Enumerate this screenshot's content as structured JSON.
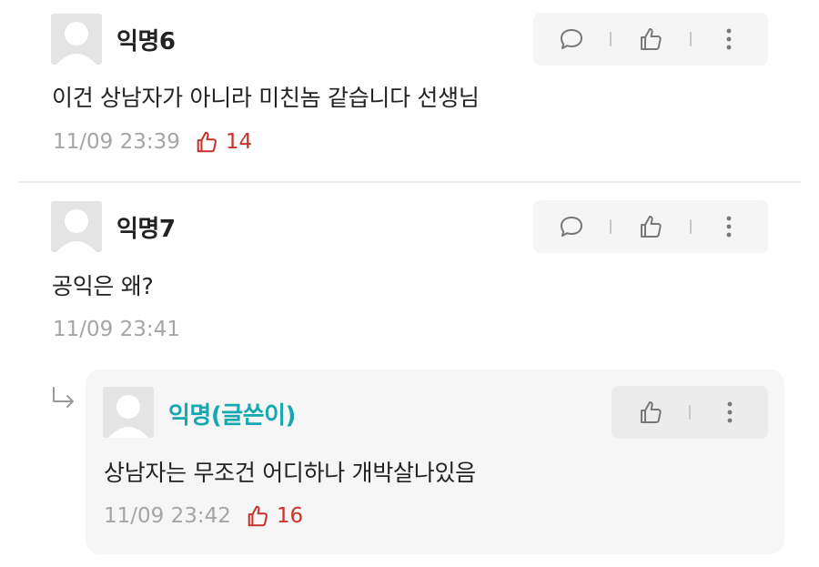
{
  "comments": [
    {
      "author": "익명6",
      "text": "이건 상남자가 아니라 미친놈 같습니다 선생님",
      "timestamp": "11/09 23:39",
      "likes": "14",
      "actions": [
        "comment-icon",
        "thumbs-up-icon",
        "more-icon"
      ]
    },
    {
      "author": "익명7",
      "text": "공익은 왜?",
      "timestamp": "11/09 23:41",
      "actions": [
        "comment-icon",
        "thumbs-up-icon",
        "more-icon"
      ]
    }
  ],
  "reply": {
    "author": "익명(글쓴이)",
    "text": "상남자는 무조건 어디하나 개박살나있음",
    "timestamp": "11/09 23:42",
    "likes": "16",
    "actions": [
      "thumbs-up-icon",
      "more-icon"
    ]
  },
  "colors": {
    "op_author": "#16a8b0",
    "like_count": "#c8322a",
    "meta_gray": "#a5a5a5",
    "action_bg": "#f5f5f5"
  }
}
